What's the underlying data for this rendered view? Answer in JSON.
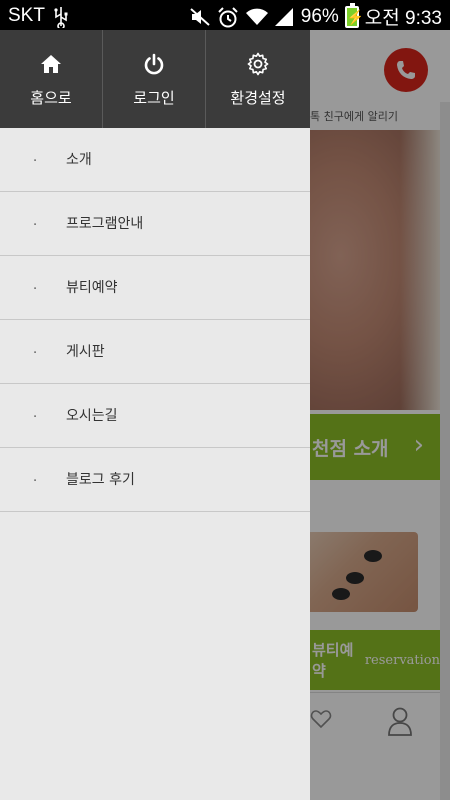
{
  "status_bar": {
    "carrier": "SKT",
    "battery_percent": "96%",
    "time": "오전 9:33",
    "icons": [
      "usb-icon",
      "mute-icon",
      "alarm-icon",
      "wifi-icon",
      "signal-icon",
      "battery-icon"
    ]
  },
  "background_app": {
    "share_text": "톡 친구에게 알리기",
    "banner_text": "천점 소개",
    "banner_chevron": "›",
    "reservation_main": "뷰티예약",
    "reservation_sub": "reservation",
    "accent_color": "#8cbf27",
    "call_color": "#d9251c"
  },
  "drawer": {
    "header_buttons": [
      {
        "label": "홈으로",
        "icon": "home-icon"
      },
      {
        "label": "로그인",
        "icon": "power-icon"
      },
      {
        "label": "환경설정",
        "icon": "gear-icon"
      }
    ],
    "bullet": "·",
    "menu_items": [
      {
        "label": "소개"
      },
      {
        "label": "프로그램안내"
      },
      {
        "label": "뷰티예약"
      },
      {
        "label": "게시판"
      },
      {
        "label": "오시는길"
      },
      {
        "label": "블로그 후기"
      }
    ]
  }
}
